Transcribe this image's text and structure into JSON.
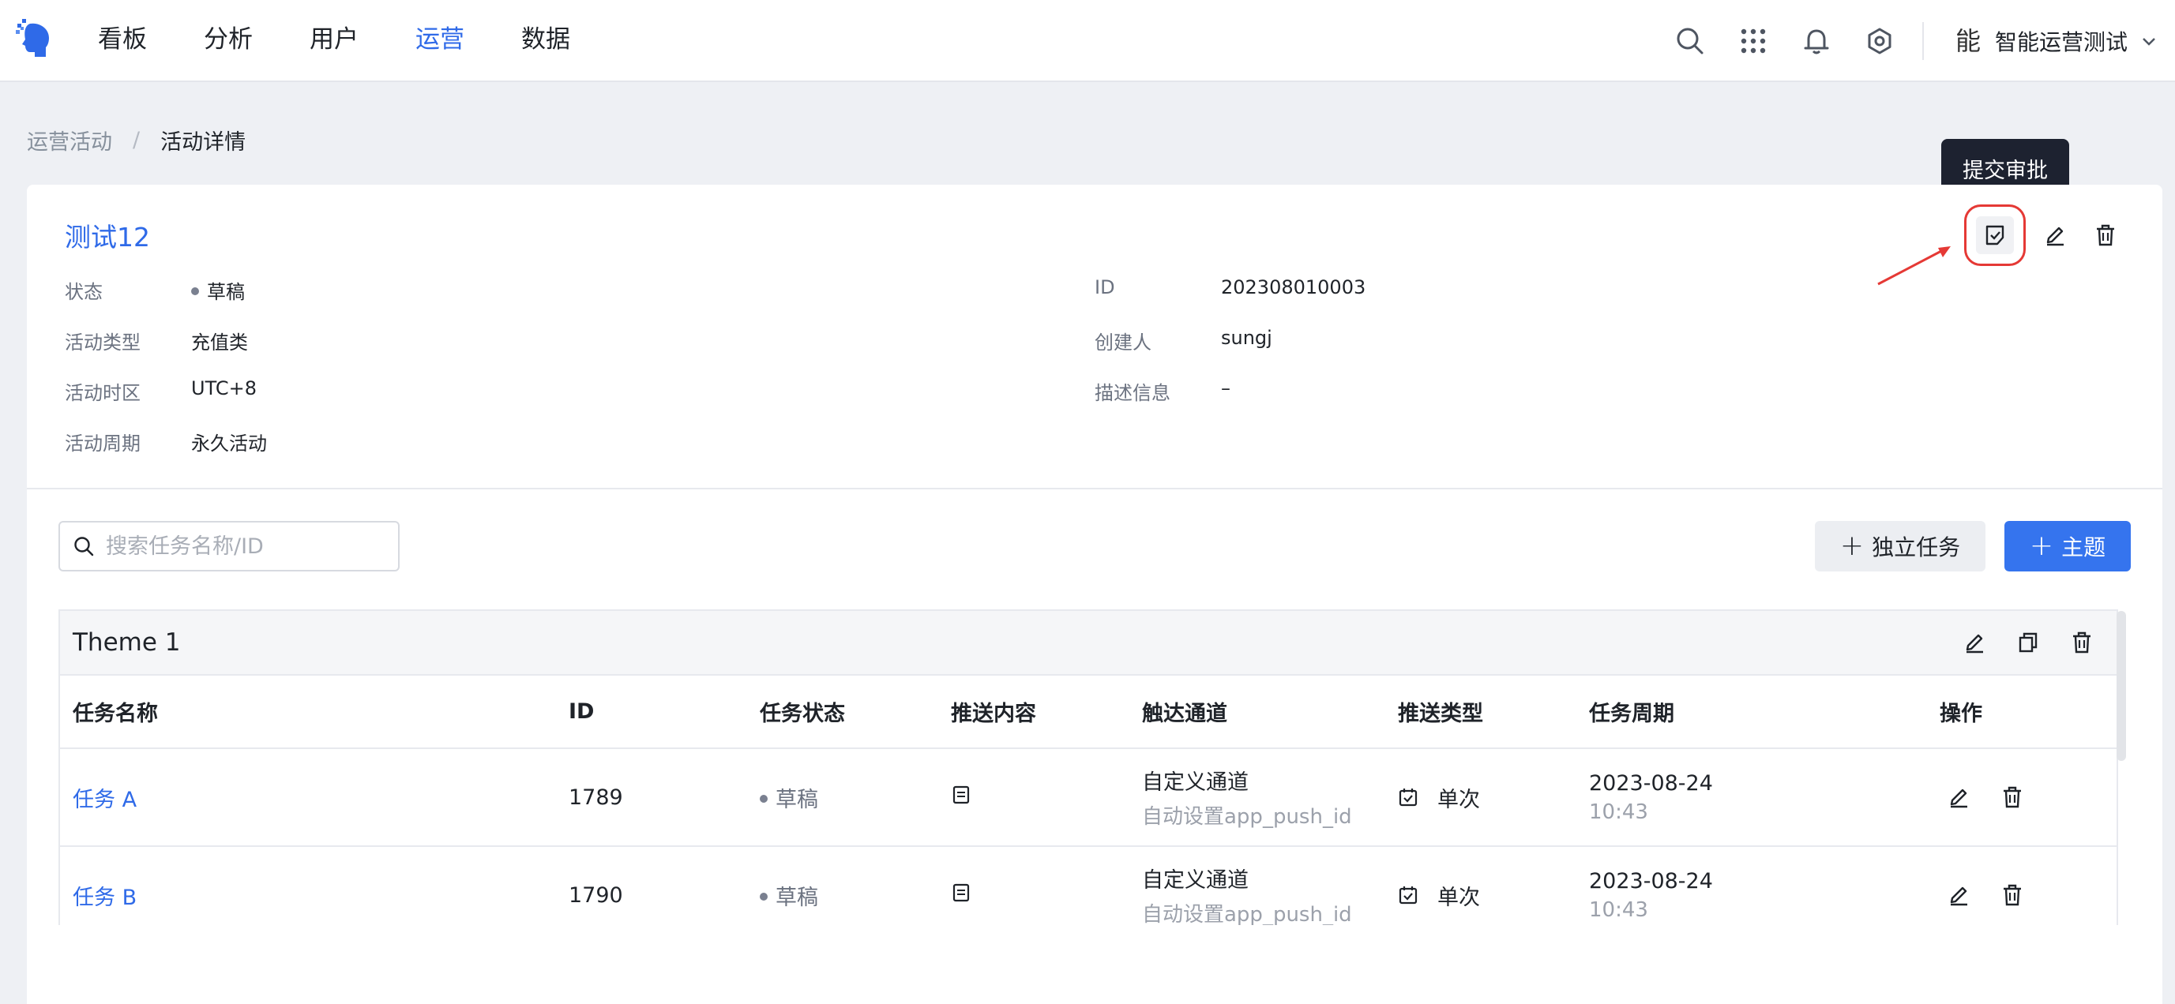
{
  "nav": {
    "items": [
      {
        "label": "看板",
        "active": false
      },
      {
        "label": "分析",
        "active": false
      },
      {
        "label": "用户",
        "active": false
      },
      {
        "label": "运营",
        "active": true
      },
      {
        "label": "数据",
        "active": false
      }
    ],
    "icons": [
      "search-icon",
      "apps-grid-icon",
      "bell-icon",
      "settings-icon"
    ],
    "user_avatar": "能",
    "user_name": "智能运营测试"
  },
  "breadcrumb": {
    "parent": "运营活动",
    "separator": "/",
    "current": "活动详情"
  },
  "activity": {
    "title": "测试12",
    "tooltip": "提交审批",
    "fields_left": [
      {
        "label": "状态",
        "value": "草稿"
      },
      {
        "label": "活动类型",
        "value": "充值类"
      },
      {
        "label": "活动时区",
        "value": "UTC+8"
      },
      {
        "label": "活动周期",
        "value": "永久活动"
      }
    ],
    "fields_right": [
      {
        "label": "ID",
        "value": "202308010003"
      },
      {
        "label": "创建人",
        "value": "sungj"
      },
      {
        "label": "描述信息",
        "value": "–"
      }
    ]
  },
  "toolbar": {
    "search_placeholder": "搜索任务名称/ID",
    "independent_task_label": "独立任务",
    "theme_label": "主题"
  },
  "theme": {
    "name": "Theme 1",
    "columns": [
      "任务名称",
      "ID",
      "任务状态",
      "推送内容",
      "触达通道",
      "推送类型",
      "任务周期",
      "操作"
    ],
    "rows": [
      {
        "name": "任务 A",
        "id": "1789",
        "status": "草稿",
        "channel": "自定义通道",
        "channel_sub": "自动设置app_push_id",
        "push_type": "单次",
        "date": "2023-08-24",
        "time": "10:43"
      },
      {
        "name": "任务 B",
        "id": "1790",
        "status": "草稿",
        "channel": "自定义通道",
        "channel_sub": "自动设置app_push_id",
        "push_type": "单次",
        "date": "2023-08-24",
        "time": "10:43"
      }
    ]
  },
  "colors": {
    "accent": "#2f6ae8",
    "primary_button": "#3574ee",
    "tooltip_bg": "#1d2230",
    "highlight": "#e53935"
  }
}
